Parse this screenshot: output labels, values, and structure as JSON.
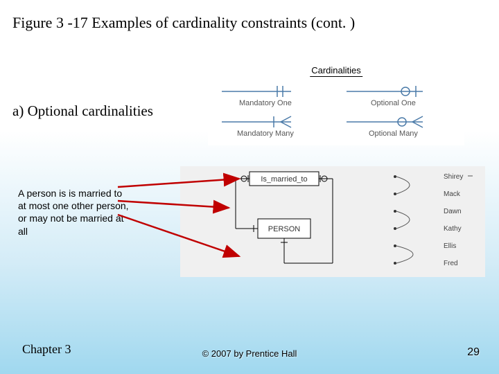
{
  "title": "Figure 3 -17 Examples of cardinality constraints (cont. )",
  "subtitle": "a) Optional cardinalities",
  "legend": {
    "heading": "Cardinalities",
    "items": [
      {
        "label": "Mandatory One"
      },
      {
        "label": "Optional One"
      },
      {
        "label": "Mandatory Many"
      },
      {
        "label": "Optional Many"
      }
    ]
  },
  "callout": "A person is is married to at most one other person, or may not be married at all",
  "diagram": {
    "entity": "PERSON",
    "relationship": "Is_married_to",
    "instances": [
      "Shirey",
      "Mack",
      "Dawn",
      "Kathy",
      "Ellis",
      "Fred"
    ]
  },
  "footer": {
    "left": "Chapter 3",
    "center": "© 2007 by Prentice Hall",
    "right": "29"
  }
}
